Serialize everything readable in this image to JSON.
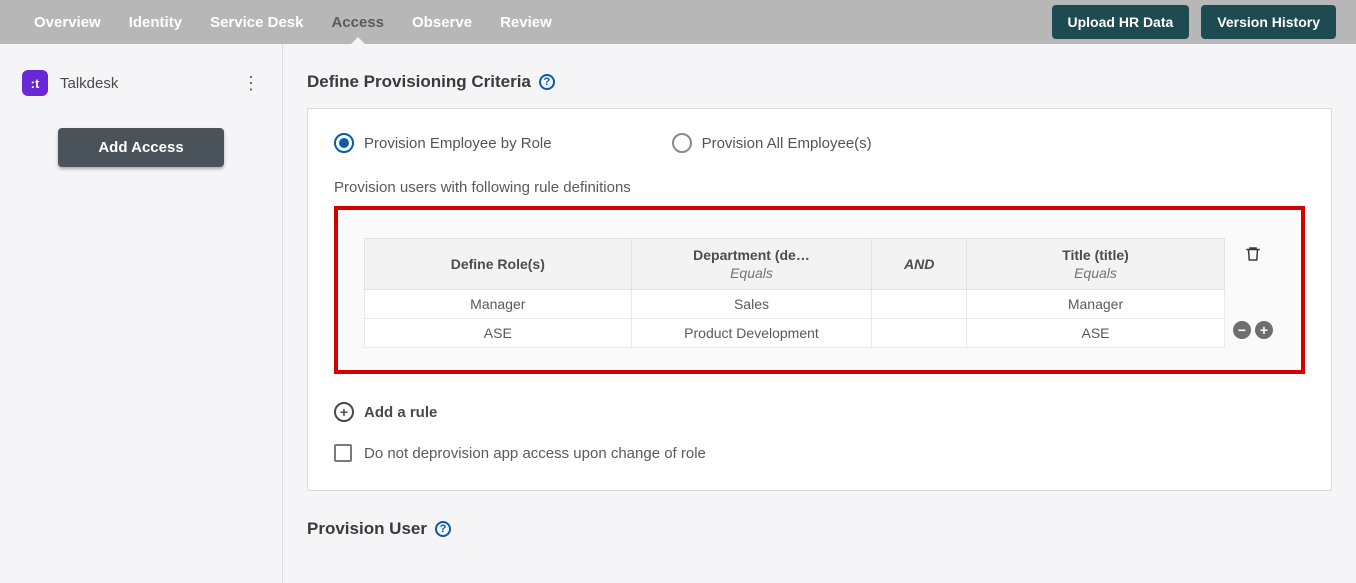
{
  "nav": {
    "tabs": [
      "Overview",
      "Identity",
      "Service Desk",
      "Access",
      "Observe",
      "Review"
    ],
    "activeIndex": 3,
    "actions": {
      "upload": "Upload HR Data",
      "history": "Version History"
    }
  },
  "sidebar": {
    "app": {
      "name": "Talkdesk",
      "iconText": ":t"
    },
    "addAccess": "Add Access"
  },
  "criteria": {
    "title": "Define Provisioning Criteria",
    "radios": {
      "byRole": "Provision Employee by Role",
      "all": "Provision All Employee(s)"
    },
    "subhead": "Provision users with following rule definitions",
    "table": {
      "headers": {
        "role": "Define Role(s)",
        "dept": "Department (de…",
        "deptSub": "Equals",
        "and": "AND",
        "title": "Title (title)",
        "titleSub": "Equals"
      },
      "rows": [
        {
          "role": "Manager",
          "dept": "Sales",
          "title": "Manager"
        },
        {
          "role": "ASE",
          "dept": "Product Development",
          "title": "ASE"
        }
      ]
    },
    "addRule": "Add a rule",
    "noDeprovision": "Do not deprovision app access upon change of role"
  },
  "nextSection": {
    "title": "Provision User"
  }
}
